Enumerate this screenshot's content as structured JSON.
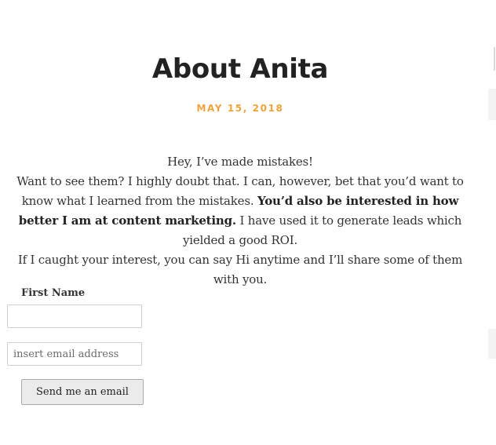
{
  "post": {
    "title": "About Anita",
    "date": "MAY 15, 2018"
  },
  "content": {
    "line1": "Hey, I’ve made mistakes!",
    "line2": "Want to see them? I highly doubt that. I can, however, bet that you’d want to know what I learned from the mistakes. ",
    "bold": "You’d also be interested in how better I am at content marketing.",
    "line2_tail": " I have used it to generate leads which yielded a good ROI.",
    "line3": "If I caught your interest, you can say Hi anytime and I’ll share some of them with you."
  },
  "form": {
    "first_name_label": "First Name",
    "first_name_value": "",
    "email_placeholder": "insert email address",
    "email_value": "",
    "submit_label": "Send me an email"
  },
  "colors": {
    "date_accent": "#f0a33a",
    "title": "#222222",
    "body_text": "#333333"
  }
}
